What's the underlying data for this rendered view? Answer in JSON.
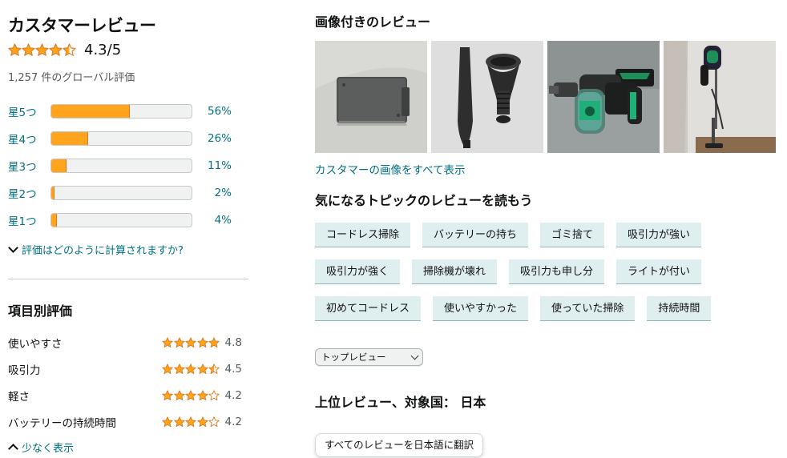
{
  "reviews": {
    "title": "カスタマーレビュー",
    "rating_text": "4.3/5",
    "rating_value": 4.3,
    "global_count": "1,257 件のグローバル評価",
    "histogram": [
      {
        "label": "星5つ",
        "pct": "56%",
        "value": 56
      },
      {
        "label": "星4つ",
        "pct": "26%",
        "value": 26
      },
      {
        "label": "星3つ",
        "pct": "11%",
        "value": 11
      },
      {
        "label": "星2つ",
        "pct": "2%",
        "value": 2
      },
      {
        "label": "星1つ",
        "pct": "4%",
        "value": 4
      }
    ],
    "how_calculated": "評価はどのように計算されますか?",
    "features_title": "項目別評価",
    "features": [
      {
        "name": "使いやすさ",
        "value": "4.8",
        "rating": 4.8
      },
      {
        "name": "吸引力",
        "value": "4.5",
        "rating": 4.5
      },
      {
        "name": "軽さ",
        "value": "4.2",
        "rating": 4.2
      },
      {
        "name": "バッテリーの持続時間",
        "value": "4.2",
        "rating": 4.2
      }
    ],
    "show_less": "少なく表示"
  },
  "images": {
    "title": "画像付きのレビュー",
    "see_all": "カスタマーの画像をすべて表示"
  },
  "topics": {
    "title": "気になるトピックのレビューを読もう",
    "rows": [
      [
        "コードレス掃除",
        "バッテリーの持ち",
        "ゴミ捨て",
        "吸引力が強い"
      ],
      [
        "吸引力が強く",
        "掃除機が壊れ",
        "吸引力も申し分",
        "ライトが付い"
      ],
      [
        "初めてコードレス",
        "使いやすかった",
        "使っていた掃除",
        "持続時間"
      ]
    ]
  },
  "sort": {
    "selected": "トップレビュー"
  },
  "top_reviews_title": "上位レビュー、対象国： 日本",
  "translate_button": "すべてのレビューを日本語に翻訳",
  "colors": {
    "star": "#de7921",
    "bar_fill": "#ffa41c",
    "link": "#007185",
    "chip_bg": "#dfeeef"
  }
}
